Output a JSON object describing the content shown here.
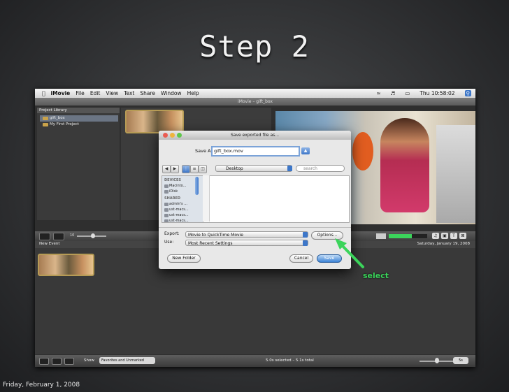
{
  "slide": {
    "title": "Step 2",
    "footer_date": "Friday, February 1, 2008",
    "annotation": "select",
    "annotation_color": "#3bd45b"
  },
  "menubar": {
    "app": "iMovie",
    "items": [
      "File",
      "Edit",
      "View",
      "Text",
      "Share",
      "Window",
      "Help"
    ],
    "clock": "Thu 10:58:02"
  },
  "window": {
    "title": "iMovie – gift_box"
  },
  "project_library": {
    "header": "Project Library",
    "items": [
      "gift_box",
      "My First Project"
    ]
  },
  "toolbar": {
    "zoom_value": "10"
  },
  "event": {
    "title": "New Event",
    "date": "Saturday, January 19, 2008"
  },
  "bottom_bar": {
    "show_label": "Show",
    "show_value": "Favorites and Unmarked",
    "status": "5.0s selected – 5.1s total",
    "zoom_value": "5s"
  },
  "dialog": {
    "title": "Save exported file as...",
    "save_as_label": "Save As:",
    "filename": "gift_box.mov",
    "location": "Desktop",
    "search_placeholder": "search",
    "sidebar": {
      "devices_header": "DEVICES",
      "devices": [
        "Macinto...",
        "iDisk"
      ],
      "shared_header": "SHARED",
      "shared": [
        "admin's ...",
        "ust-macs...",
        "ust-macs...",
        "ust-macs..."
      ]
    },
    "export_label": "Export:",
    "export_value": "Movie to QuickTime Movie",
    "use_label": "Use:",
    "use_value": "Most Recent Settings",
    "options_button": "Options...",
    "new_folder_button": "New Folder",
    "cancel_button": "Cancel",
    "save_button": "Save"
  }
}
